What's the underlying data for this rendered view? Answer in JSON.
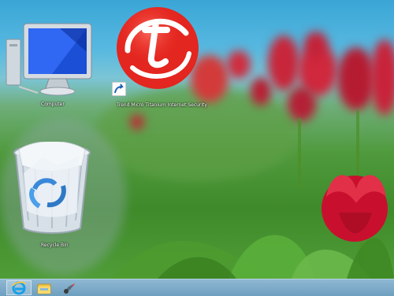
{
  "desktop": {
    "icons": [
      {
        "label": "Computer"
      },
      {
        "label": "Trend Micro Titanium Internet Security"
      },
      {
        "label": "Recycle Bin"
      }
    ]
  },
  "taskbar": {
    "items": [
      {
        "icon": "internet-explorer-icon"
      },
      {
        "icon": "file-explorer-icon"
      },
      {
        "icon": "paint-icon"
      }
    ]
  },
  "colors": {
    "taskbar": "#7aa9c6",
    "trend_red": "#e3261f",
    "tulip_red": "#c8102e"
  }
}
